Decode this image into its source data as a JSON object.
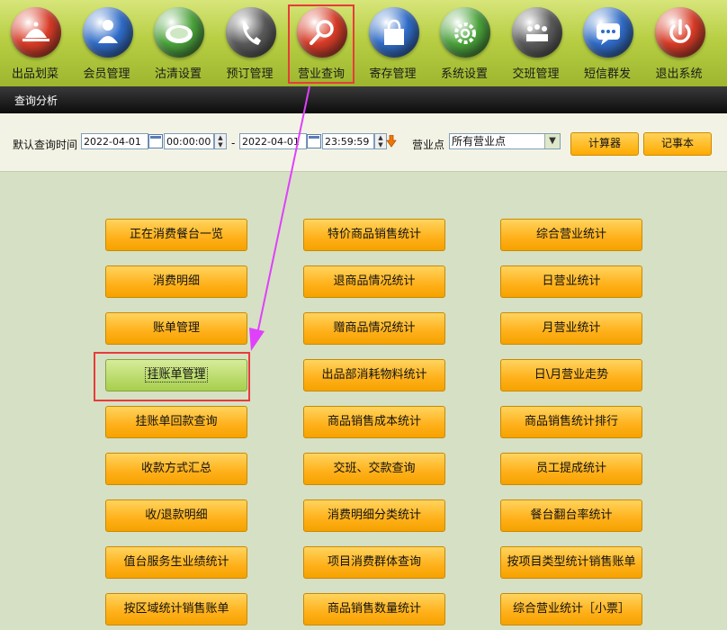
{
  "toolbar": {
    "items": [
      {
        "label": "出品划菜",
        "icon": "serving-cloche-icon",
        "color": "#d93b26"
      },
      {
        "label": "会员管理",
        "icon": "member-person-icon",
        "color": "#2f6cc9"
      },
      {
        "label": "沽清设置",
        "icon": "plate-icon",
        "color": "#4aa33a"
      },
      {
        "label": "预订管理",
        "icon": "telephone-icon",
        "color": "#5a5a5a"
      },
      {
        "label": "营业查询",
        "icon": "magnifier-icon",
        "color": "#d93b26"
      },
      {
        "label": "寄存管理",
        "icon": "bag-icon",
        "color": "#2f6cc9"
      },
      {
        "label": "系统设置",
        "icon": "gear-icon",
        "color": "#4aa33a"
      },
      {
        "label": "交班管理",
        "icon": "meeting-icon",
        "color": "#5a5a5a"
      },
      {
        "label": "短信群发",
        "icon": "message-icon",
        "color": "#2f6cc9"
      },
      {
        "label": "退出系统",
        "icon": "power-icon",
        "color": "#d93b26"
      }
    ]
  },
  "tab": {
    "label": "查询分析"
  },
  "filter": {
    "label": "默认查询时间",
    "start_date": "2022-04-01",
    "start_time": "00:00:00",
    "separator": "-",
    "end_date": "2022-04-01",
    "end_time": "23:59:59",
    "outlet_label": "营业点",
    "outlet_value": "所有营业点",
    "calculator": "计算器",
    "notepad": "记事本"
  },
  "menu": {
    "col1": [
      "正在消费餐台一览",
      "消费明细",
      "账单管理",
      "挂账单管理",
      "挂账单回款查询",
      "收款方式汇总",
      "收/退款明细",
      "值台服务生业绩统计",
      "按区域统计销售账单"
    ],
    "col2": [
      "特价商品销售统计",
      "退商品情况统计",
      "赠商品情况统计",
      "出品部消耗物料统计",
      "商品销售成本统计",
      "交班、交款查询",
      "消费明细分类统计",
      "项目消费群体查询",
      "商品销售数量统计"
    ],
    "col3": [
      "综合营业统计",
      "日营业统计",
      "月营业统计",
      "日\\月营业走势",
      "商品销售统计排行",
      "员工提成统计",
      "餐台翻台率统计",
      "按项目类型统计销售账单",
      "综合营业统计［小票］"
    ],
    "selected": "挂账单管理"
  },
  "annotation": {
    "color": "#e83b3b",
    "arrow_color": "#e040fb"
  }
}
